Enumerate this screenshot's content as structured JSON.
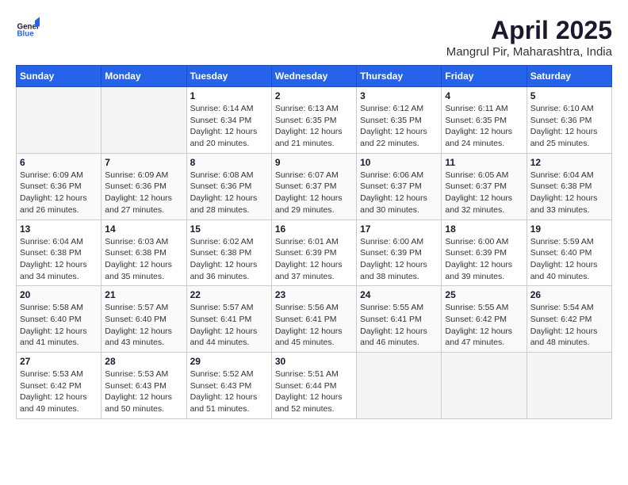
{
  "header": {
    "logo_general": "General",
    "logo_blue": "Blue",
    "month_title": "April 2025",
    "location": "Mangrul Pir, Maharashtra, India"
  },
  "days_of_week": [
    "Sunday",
    "Monday",
    "Tuesday",
    "Wednesday",
    "Thursday",
    "Friday",
    "Saturday"
  ],
  "weeks": [
    [
      {
        "day": "",
        "info": ""
      },
      {
        "day": "",
        "info": ""
      },
      {
        "day": "1",
        "info": "Sunrise: 6:14 AM\nSunset: 6:34 PM\nDaylight: 12 hours and 20 minutes."
      },
      {
        "day": "2",
        "info": "Sunrise: 6:13 AM\nSunset: 6:35 PM\nDaylight: 12 hours and 21 minutes."
      },
      {
        "day": "3",
        "info": "Sunrise: 6:12 AM\nSunset: 6:35 PM\nDaylight: 12 hours and 22 minutes."
      },
      {
        "day": "4",
        "info": "Sunrise: 6:11 AM\nSunset: 6:35 PM\nDaylight: 12 hours and 24 minutes."
      },
      {
        "day": "5",
        "info": "Sunrise: 6:10 AM\nSunset: 6:36 PM\nDaylight: 12 hours and 25 minutes."
      }
    ],
    [
      {
        "day": "6",
        "info": "Sunrise: 6:09 AM\nSunset: 6:36 PM\nDaylight: 12 hours and 26 minutes."
      },
      {
        "day": "7",
        "info": "Sunrise: 6:09 AM\nSunset: 6:36 PM\nDaylight: 12 hours and 27 minutes."
      },
      {
        "day": "8",
        "info": "Sunrise: 6:08 AM\nSunset: 6:36 PM\nDaylight: 12 hours and 28 minutes."
      },
      {
        "day": "9",
        "info": "Sunrise: 6:07 AM\nSunset: 6:37 PM\nDaylight: 12 hours and 29 minutes."
      },
      {
        "day": "10",
        "info": "Sunrise: 6:06 AM\nSunset: 6:37 PM\nDaylight: 12 hours and 30 minutes."
      },
      {
        "day": "11",
        "info": "Sunrise: 6:05 AM\nSunset: 6:37 PM\nDaylight: 12 hours and 32 minutes."
      },
      {
        "day": "12",
        "info": "Sunrise: 6:04 AM\nSunset: 6:38 PM\nDaylight: 12 hours and 33 minutes."
      }
    ],
    [
      {
        "day": "13",
        "info": "Sunrise: 6:04 AM\nSunset: 6:38 PM\nDaylight: 12 hours and 34 minutes."
      },
      {
        "day": "14",
        "info": "Sunrise: 6:03 AM\nSunset: 6:38 PM\nDaylight: 12 hours and 35 minutes."
      },
      {
        "day": "15",
        "info": "Sunrise: 6:02 AM\nSunset: 6:38 PM\nDaylight: 12 hours and 36 minutes."
      },
      {
        "day": "16",
        "info": "Sunrise: 6:01 AM\nSunset: 6:39 PM\nDaylight: 12 hours and 37 minutes."
      },
      {
        "day": "17",
        "info": "Sunrise: 6:00 AM\nSunset: 6:39 PM\nDaylight: 12 hours and 38 minutes."
      },
      {
        "day": "18",
        "info": "Sunrise: 6:00 AM\nSunset: 6:39 PM\nDaylight: 12 hours and 39 minutes."
      },
      {
        "day": "19",
        "info": "Sunrise: 5:59 AM\nSunset: 6:40 PM\nDaylight: 12 hours and 40 minutes."
      }
    ],
    [
      {
        "day": "20",
        "info": "Sunrise: 5:58 AM\nSunset: 6:40 PM\nDaylight: 12 hours and 41 minutes."
      },
      {
        "day": "21",
        "info": "Sunrise: 5:57 AM\nSunset: 6:40 PM\nDaylight: 12 hours and 43 minutes."
      },
      {
        "day": "22",
        "info": "Sunrise: 5:57 AM\nSunset: 6:41 PM\nDaylight: 12 hours and 44 minutes."
      },
      {
        "day": "23",
        "info": "Sunrise: 5:56 AM\nSunset: 6:41 PM\nDaylight: 12 hours and 45 minutes."
      },
      {
        "day": "24",
        "info": "Sunrise: 5:55 AM\nSunset: 6:41 PM\nDaylight: 12 hours and 46 minutes."
      },
      {
        "day": "25",
        "info": "Sunrise: 5:55 AM\nSunset: 6:42 PM\nDaylight: 12 hours and 47 minutes."
      },
      {
        "day": "26",
        "info": "Sunrise: 5:54 AM\nSunset: 6:42 PM\nDaylight: 12 hours and 48 minutes."
      }
    ],
    [
      {
        "day": "27",
        "info": "Sunrise: 5:53 AM\nSunset: 6:42 PM\nDaylight: 12 hours and 49 minutes."
      },
      {
        "day": "28",
        "info": "Sunrise: 5:53 AM\nSunset: 6:43 PM\nDaylight: 12 hours and 50 minutes."
      },
      {
        "day": "29",
        "info": "Sunrise: 5:52 AM\nSunset: 6:43 PM\nDaylight: 12 hours and 51 minutes."
      },
      {
        "day": "30",
        "info": "Sunrise: 5:51 AM\nSunset: 6:44 PM\nDaylight: 12 hours and 52 minutes."
      },
      {
        "day": "",
        "info": ""
      },
      {
        "day": "",
        "info": ""
      },
      {
        "day": "",
        "info": ""
      }
    ]
  ]
}
